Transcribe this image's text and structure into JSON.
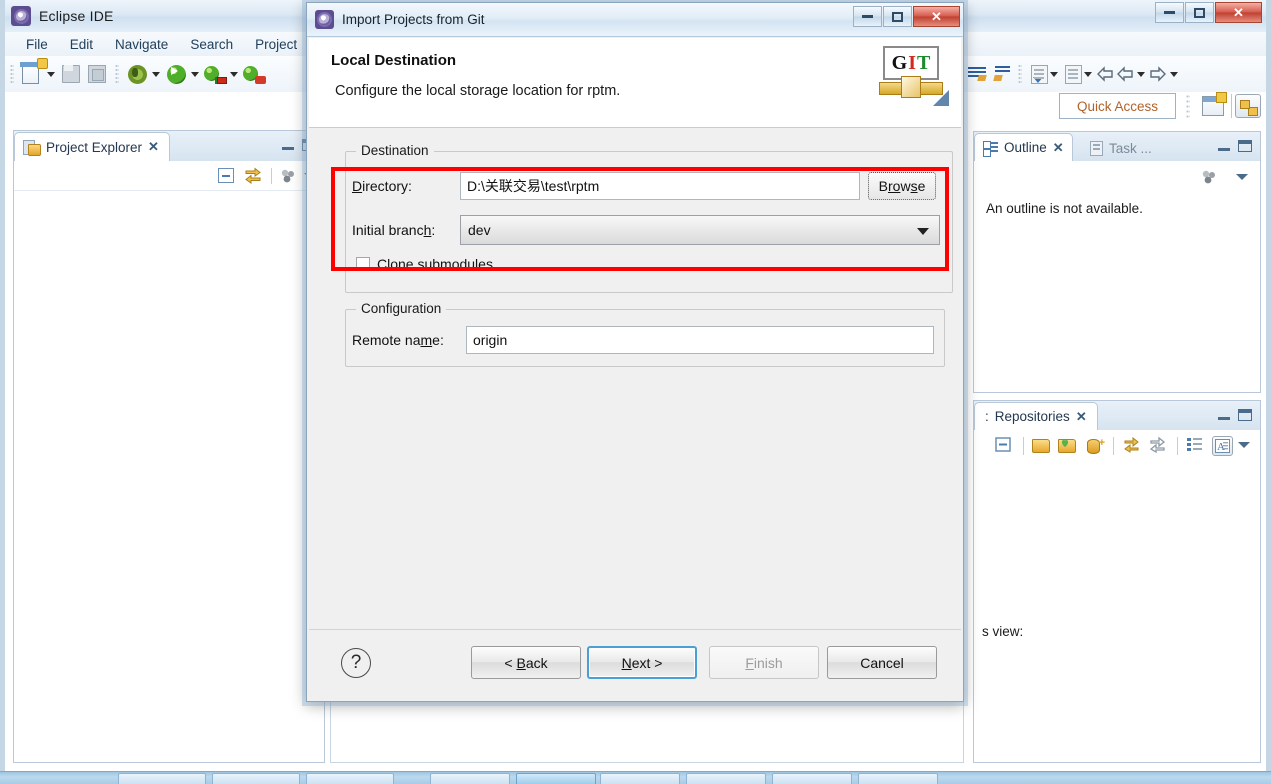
{
  "app": {
    "title": "Eclipse IDE",
    "icon": "eclipse-icon",
    "window_controls": {
      "minimize": "minimize-icon",
      "maximize": "maximize-icon",
      "close": "close-icon"
    }
  },
  "menubar": {
    "items": [
      {
        "label": "File"
      },
      {
        "label": "Edit"
      },
      {
        "label": "Navigate"
      },
      {
        "label": "Search"
      },
      {
        "label": "Project"
      }
    ]
  },
  "toolbar": {
    "left_icons": [
      "new-document-icon",
      "dropdown-arrow-icon",
      "save-icon",
      "save-all-icon",
      "debug-icon",
      "dropdown-arrow-icon",
      "run-icon",
      "dropdown-arrow-icon",
      "run-configurations-icon",
      "dropdown-arrow-icon",
      "run-server-icon"
    ],
    "right_icons": [
      "skip-breakpoints-icon",
      "step-into-icon",
      "open-type-icon",
      "dropdown-arrow-icon",
      "open-task-icon",
      "dropdown-arrow-icon",
      "back-hollow-icon",
      "previous-annotation-icon",
      "dropdown-arrow-icon",
      "next-annotation-icon",
      "dropdown-arrow-icon"
    ],
    "quick_access": "Quick Access",
    "open_perspective": "open-perspective-icon",
    "current_perspective": "java-perspective-icon"
  },
  "project_explorer": {
    "tab_label": "Project Explorer",
    "tab_icon": "project-explorer-icon",
    "close": "close-tab-icon",
    "minimize": "minimize-view-icon",
    "maximize": "maximize-view-icon",
    "tools": [
      "collapse-all-icon",
      "link-with-editor-icon",
      "view-menu-icon",
      "view-dropdown-icon"
    ]
  },
  "outline_view": {
    "tab_label": "Outline",
    "tab_icon": "outline-icon",
    "close": "close-tab-icon",
    "second_tab_label": "Task ...",
    "second_tab_icon": "task-list-icon",
    "empty_message": "An outline is not available.",
    "tools": [
      "sync-icon",
      "view-dropdown-icon"
    ],
    "minimize": "minimize-view-icon",
    "maximize": "maximize-view-icon"
  },
  "repositories_view": {
    "tab_label": "Repositories",
    "tab_prefix": ":",
    "close": "close-tab-icon",
    "minimize": "minimize-view-icon",
    "maximize": "maximize-view-icon",
    "tools": [
      "collapse-all-icon",
      "add-repository-icon",
      "clone-repository-icon",
      "create-repository-icon",
      "fetch-icon",
      "push-icon",
      "hierarchy-layout-icon",
      "toggle-branch-label-icon",
      "view-dropdown-icon"
    ],
    "partial_text": "s view:"
  },
  "dialog": {
    "title": "Import Projects from Git",
    "title_icon": "eclipse-icon",
    "window_controls": {
      "minimize": "minimize-icon",
      "maximize": "maximize-icon",
      "close": "close-icon"
    },
    "header": {
      "title": "Local Destination",
      "description": "Configure the local storage location for rptm.",
      "logo": "git-logo-icon",
      "logo_text": {
        "g": "G",
        "i": "I",
        "t": "T"
      }
    },
    "destination_group": {
      "legend": "Destination",
      "directory_label": "Directory:",
      "directory_value": "D:\\关联交易\\test\\rptm",
      "browse_button": "Browse",
      "initial_branch_label": "Initial branch:",
      "initial_branch_value": "dev",
      "clone_submodules_label": "Clone submodules",
      "clone_submodules_checked": false
    },
    "configuration_group": {
      "legend": "Configuration",
      "remote_name_label": "Remote name:",
      "remote_name_value": "origin"
    },
    "footer": {
      "help_icon": "help-icon",
      "back_button": "< Back",
      "next_button": "Next >",
      "finish_button": "Finish",
      "cancel_button": "Cancel",
      "finish_disabled": true,
      "default_button": "Next >"
    }
  },
  "annotation": {
    "highlight_color": "#ff0000",
    "highlight_target": "destination-fields"
  },
  "taskbar": {
    "items": [
      "task-1",
      "task-2",
      "task-3",
      "task-4",
      "task-5",
      "task-6",
      "task-7",
      "task-8",
      "task-9",
      "task-10"
    ]
  },
  "colors": {
    "accent": "#4a9fd4",
    "highlight": "#ff0000",
    "titlebar": "#dce9f5",
    "dialog_bg": "#f0f0f0"
  }
}
